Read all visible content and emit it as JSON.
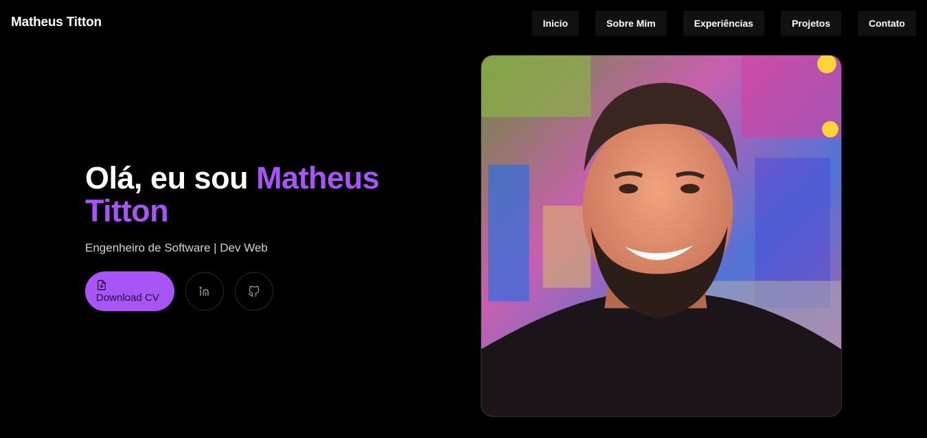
{
  "header": {
    "brand": "Matheus Titton",
    "nav": [
      {
        "label": "Inicio"
      },
      {
        "label": "Sobre Mim"
      },
      {
        "label": "Experiências"
      },
      {
        "label": "Projetos"
      },
      {
        "label": "Contato"
      }
    ]
  },
  "hero": {
    "greeting": "Olá, eu sou ",
    "name_line1": "Matheus",
    "name_line2": "Titton",
    "subtitle": "Engenheiro de Software | Dev Web",
    "download_label": "Download CV",
    "download_icon": "file-download-icon",
    "linkedin_icon": "linkedin-icon",
    "github_icon": "github-icon"
  },
  "colors": {
    "accent": "#a855f7",
    "background": "#000000",
    "nav_bg": "#111111"
  }
}
